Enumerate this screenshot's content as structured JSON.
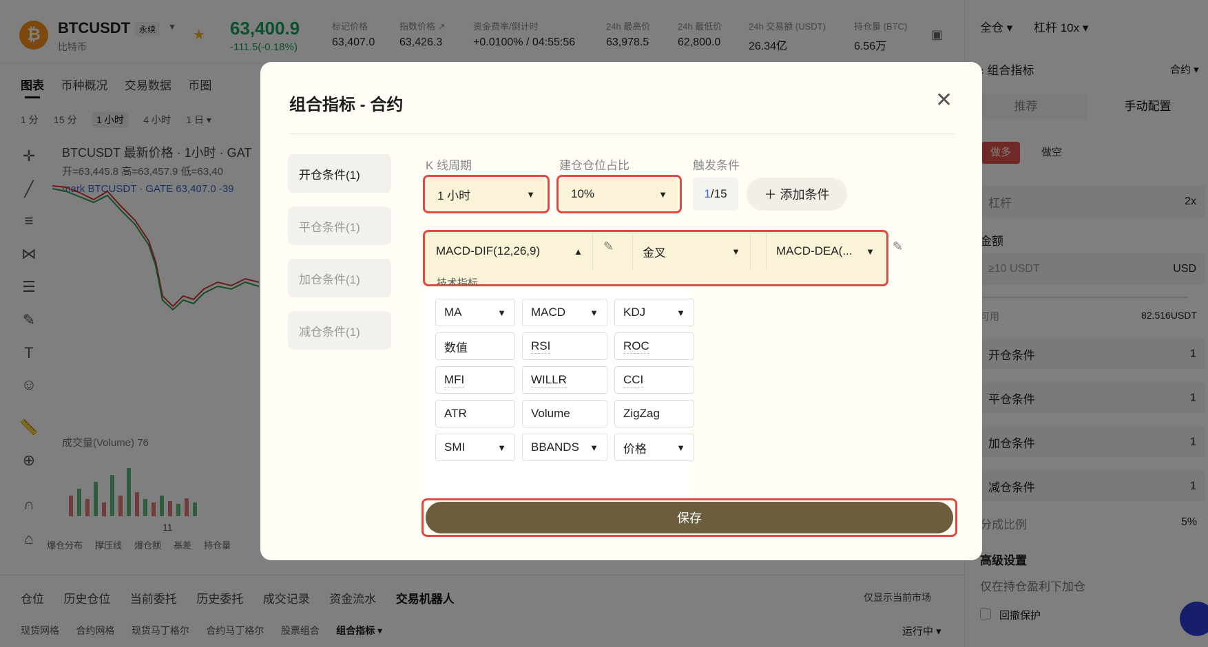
{
  "header": {
    "symbol": "BTCUSDT",
    "perp_badge": "永续",
    "sub_name": "比特币",
    "last_price": "63,400.9",
    "change": "-111.5(-0.18%)",
    "stats": [
      {
        "label": "标记价格",
        "value": "63,407.0"
      },
      {
        "label": "指数价格 ↗",
        "value": "63,426.3"
      },
      {
        "label": "资金费率/倒计时",
        "value": "+0.0100% / 04:55:56"
      },
      {
        "label": "24h 最高价",
        "value": "63,978.5"
      },
      {
        "label": "24h 最低价",
        "value": "62,800.0"
      },
      {
        "label": "24h 交易额 (USDT)",
        "value": "26.34亿"
      },
      {
        "label": "持仓量 (BTC)",
        "value": "6.56万"
      }
    ]
  },
  "chart_tabs": [
    "图表",
    "币种概况",
    "交易数据",
    "币圈"
  ],
  "timeframes": [
    "1 分",
    "15 分",
    "1 小时",
    "4 小时",
    "1 日 ▾"
  ],
  "chart": {
    "title": "BTCUSDT 最新价格 · 1小时 · GAT",
    "ohlc": "开=63,445.8  高=63,457.9  低=63,40",
    "mark": "mark  BTCUSDT · GATE  63,407.0  -39",
    "volume": "成交量(Volume)  76",
    "xtick": "11",
    "bottom_tools": [
      "爆仓分布",
      "撑压线",
      "爆仓额",
      "基差",
      "持仓量"
    ]
  },
  "right_panel": {
    "margin_mode": "全仓 ▾",
    "leverage_top": "杠杆 10x ▾",
    "back_title": "‹ 组合指标",
    "contract": "合约 ▾",
    "tabs": [
      "推荐",
      "手动配置"
    ],
    "long": "做多",
    "short": "做空",
    "leverage_label": "杠杆",
    "leverage_value": "2x",
    "amount_label": "金额",
    "amount_placeholder": "≥10 USDT",
    "amount_unit": "USD",
    "available_label": "可用",
    "available_value": "82.516USDT",
    "conditions": [
      {
        "label": "开仓条件",
        "value": "1"
      },
      {
        "label": "平仓条件",
        "value": "1"
      },
      {
        "label": "加仓条件",
        "value": "1"
      },
      {
        "label": "减仓条件",
        "value": "1"
      }
    ],
    "split_label": "分成比例",
    "split_value": "5%",
    "advanced": "高级设置",
    "add_only_profit": "仅在持仓盈利下加仓",
    "drawdown": "回撤保护"
  },
  "bottom_tabs": [
    "仓位",
    "历史仓位",
    "当前委托",
    "历史委托",
    "成交记录",
    "资金流水",
    "交易机器人"
  ],
  "bottom_sub": [
    "现货网格",
    "合约网格",
    "现货马丁格尔",
    "合约马丁格尔",
    "股票组合",
    "组合指标 ▾"
  ],
  "only_current": "仅显示当前市场",
  "running": "运行中 ▾",
  "modal": {
    "title": "组合指标 - 合约",
    "close": "✕",
    "side_tabs": [
      "开仓条件(1)",
      "平仓条件(1)",
      "加仓条件(1)",
      "减仓条件(1)"
    ],
    "kline_label": "K 线周期",
    "kline_value": "1 小时",
    "position_label": "建仓仓位占比",
    "position_value": "10%",
    "trigger_label": "触发条件",
    "trigger_count_current": "1",
    "trigger_count_total": "/15",
    "add_condition": "＋ 添加条件",
    "cond_left": "MACD-DIF(12,26,9)",
    "cond_op": "金叉",
    "cond_right": "MACD-DEA(...",
    "dropdown_header": "技术指标",
    "indicators": [
      {
        "label": "MA",
        "arrow": "▼"
      },
      {
        "label": "MACD",
        "arrow": "▼"
      },
      {
        "label": "KDJ",
        "arrow": "▼"
      },
      {
        "label": "数值",
        "arrow": ""
      },
      {
        "label": "RSI",
        "arrow": ""
      },
      {
        "label": "ROC",
        "arrow": ""
      },
      {
        "label": "MFI",
        "arrow": ""
      },
      {
        "label": "WILLR",
        "arrow": ""
      },
      {
        "label": "CCI",
        "arrow": ""
      },
      {
        "label": "ATR",
        "arrow": ""
      },
      {
        "label": "Volume",
        "arrow": ""
      },
      {
        "label": "ZigZag",
        "arrow": ""
      },
      {
        "label": "SMI",
        "arrow": "▼"
      },
      {
        "label": "BBANDS",
        "arrow": "▼"
      },
      {
        "label": "价格",
        "arrow": "▼"
      }
    ],
    "save": "保存"
  },
  "colors": {
    "accent_red": "#e5483c",
    "save_bg": "#6b5d3d",
    "highlight": "#fbf3d8",
    "up_green": "#1aa15a"
  }
}
